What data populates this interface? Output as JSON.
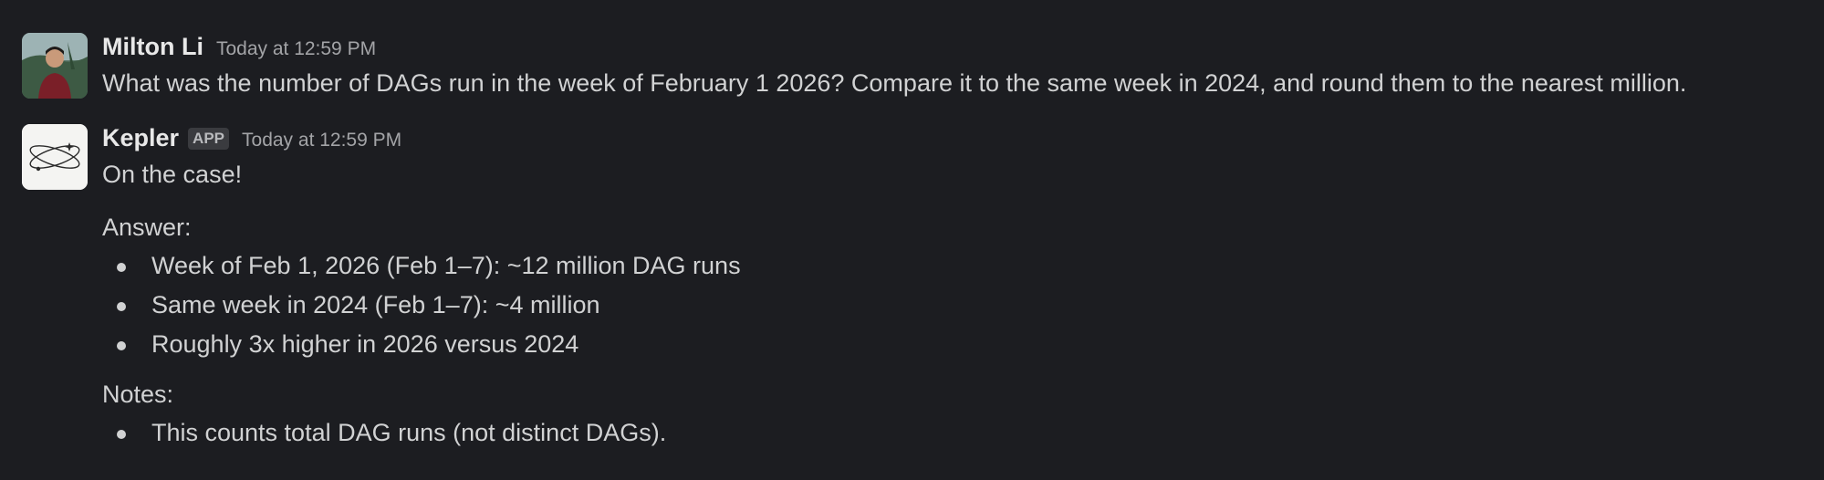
{
  "messages": [
    {
      "sender": "Milton Li",
      "timestamp": "Today at 12:59 PM",
      "avatar": "user-photo-avatar",
      "text": "What was the number of DAGs run in the week of February 1 2026? Compare it to the same week in 2024, and round them to the nearest million."
    },
    {
      "sender": "Kepler",
      "badge": "APP",
      "timestamp": "Today at 12:59 PM",
      "avatar": "kepler-orbit-logo",
      "intro": "On the case!",
      "answer_heading": "Answer:",
      "answer_items": [
        "Week of Feb 1, 2026 (Feb 1–7): ~12 million DAG runs",
        "Same week in 2024 (Feb 1–7): ~4 million",
        "Roughly 3x higher in 2026 versus 2024"
      ],
      "notes_heading": "Notes:",
      "notes_items": [
        "This counts total DAG runs (not distinct DAGs)."
      ]
    }
  ],
  "colors": {
    "background": "#1c1d21",
    "text": "#d1d2d3",
    "sender": "#e8e8e8",
    "timestamp": "#a3a4a7",
    "badge_bg": "#3a3b3f"
  }
}
